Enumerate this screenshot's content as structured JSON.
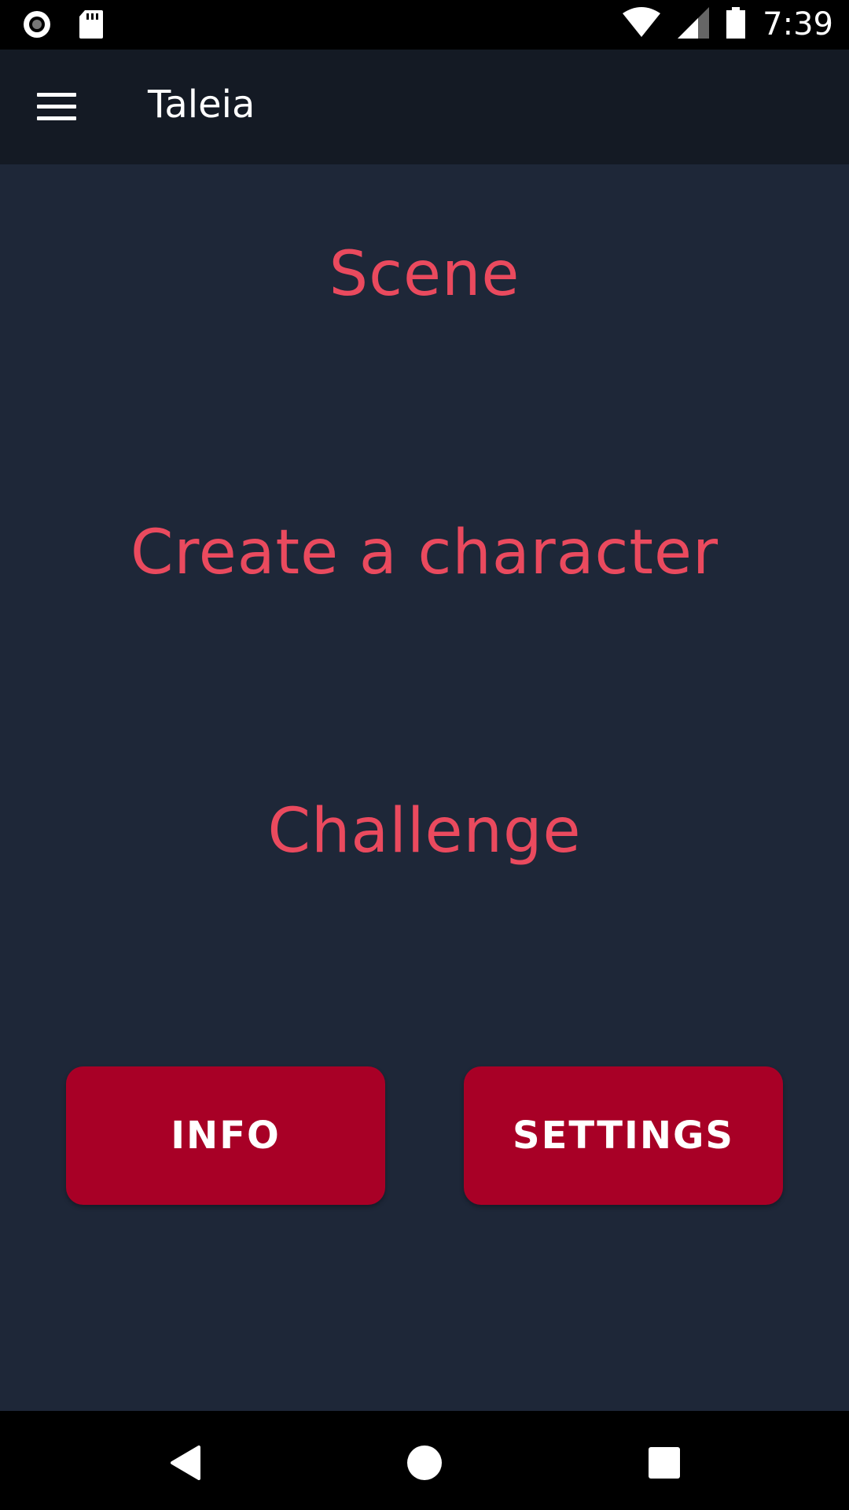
{
  "status_bar": {
    "time": "7:39",
    "icons": [
      "record-icon",
      "sd-card-icon",
      "wifi-icon",
      "signal-icon",
      "battery-icon"
    ]
  },
  "app_bar": {
    "title": "Taleia",
    "menu_icon": "hamburger-menu-icon"
  },
  "main": {
    "links": {
      "scene": "Scene",
      "create_character": "Create a character",
      "challenge": "Challenge"
    },
    "buttons": {
      "info": "INFO",
      "settings": "SETTINGS"
    }
  },
  "nav_bar": {
    "icons": [
      "back-icon",
      "home-icon",
      "recents-icon"
    ]
  },
  "colors": {
    "background": "#1e2738",
    "app_bar": "#141a24",
    "link_text": "#ea4a5e",
    "button": "#a80026"
  }
}
